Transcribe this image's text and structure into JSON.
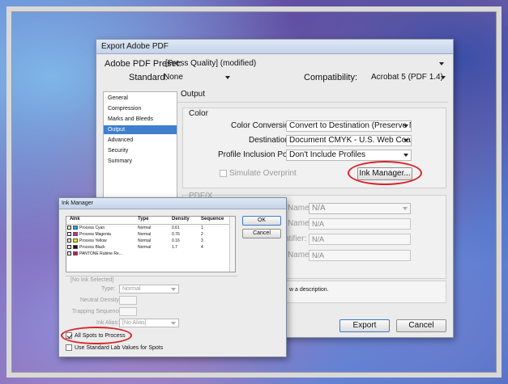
{
  "export_dialog": {
    "title": "Export Adobe PDF",
    "preset_label": "Adobe PDF Preset:",
    "preset_value": "[Press Quality] (modified)",
    "standard_label": "Standard:",
    "standard_value": "None",
    "compat_label": "Compatibility:",
    "compat_value": "Acrobat 5 (PDF 1.4)",
    "nav": [
      "General",
      "Compression",
      "Marks and Bleeds",
      "Output",
      "Advanced",
      "Security",
      "Summary"
    ],
    "selected_nav": "Output",
    "panel_title": "Output",
    "color_group": "Color",
    "color_conversion_label": "Color Conversion:",
    "color_conversion_value": "Convert to Destination (Preserve Numb",
    "destination_label": "Destination:",
    "destination_value": "Document CMYK - U.S. Web Coated (S",
    "profile_label": "Profile Inclusion Policy:",
    "profile_value": "Don't Include Profiles",
    "simulate_overprint": "Simulate Overprint",
    "ink_manager_button": "Ink Manager...",
    "pdfx_group": "PDF/X",
    "pdfx_rows": [
      {
        "label": "Name:",
        "value": "N/A"
      },
      {
        "label": "Name:",
        "value": "N/A"
      },
      {
        "label": "ntifier:",
        "value": "N/A"
      },
      {
        "label": "Name:",
        "value": "N/A"
      }
    ],
    "description_partial": "w a description.",
    "export_button": "Export",
    "cancel_button": "Cancel"
  },
  "ink_manager": {
    "title": "Ink Manager",
    "columns": [
      "",
      "Ink",
      "Type",
      "Density",
      "Sequence"
    ],
    "inks": [
      {
        "name": "Process Cyan",
        "type": "Normal",
        "density": "0.61",
        "sequence": "1",
        "color": "#19a6d8"
      },
      {
        "name": "Process Magenta",
        "type": "Normal",
        "density": "0.76",
        "sequence": "2",
        "color": "#d6249c"
      },
      {
        "name": "Process Yellow",
        "type": "Normal",
        "density": "0.16",
        "sequence": "3",
        "color": "#f3e321"
      },
      {
        "name": "Process Black",
        "type": "Normal",
        "density": "1.7",
        "sequence": "4",
        "color": "#111111"
      },
      {
        "name": "PANTONE Rubine Re...",
        "type": "",
        "density": "",
        "sequence": "",
        "color": "#c8175d"
      }
    ],
    "ok_button": "OK",
    "cancel_button": "Cancel",
    "no_ink": "[No Ink Selected]",
    "type_label": "Type:",
    "type_value": "Normal",
    "neutral_density_label": "Neutral Density:",
    "trapping_sequence_label": "Trapping Sequence:",
    "ink_alias_label": "Ink Alias:",
    "ink_alias_value": "[No Alias]",
    "all_spots": "All Spots to Process",
    "all_spots_checked": true,
    "use_lab": "Use Standard Lab Values for Spots",
    "use_lab_checked": false
  }
}
